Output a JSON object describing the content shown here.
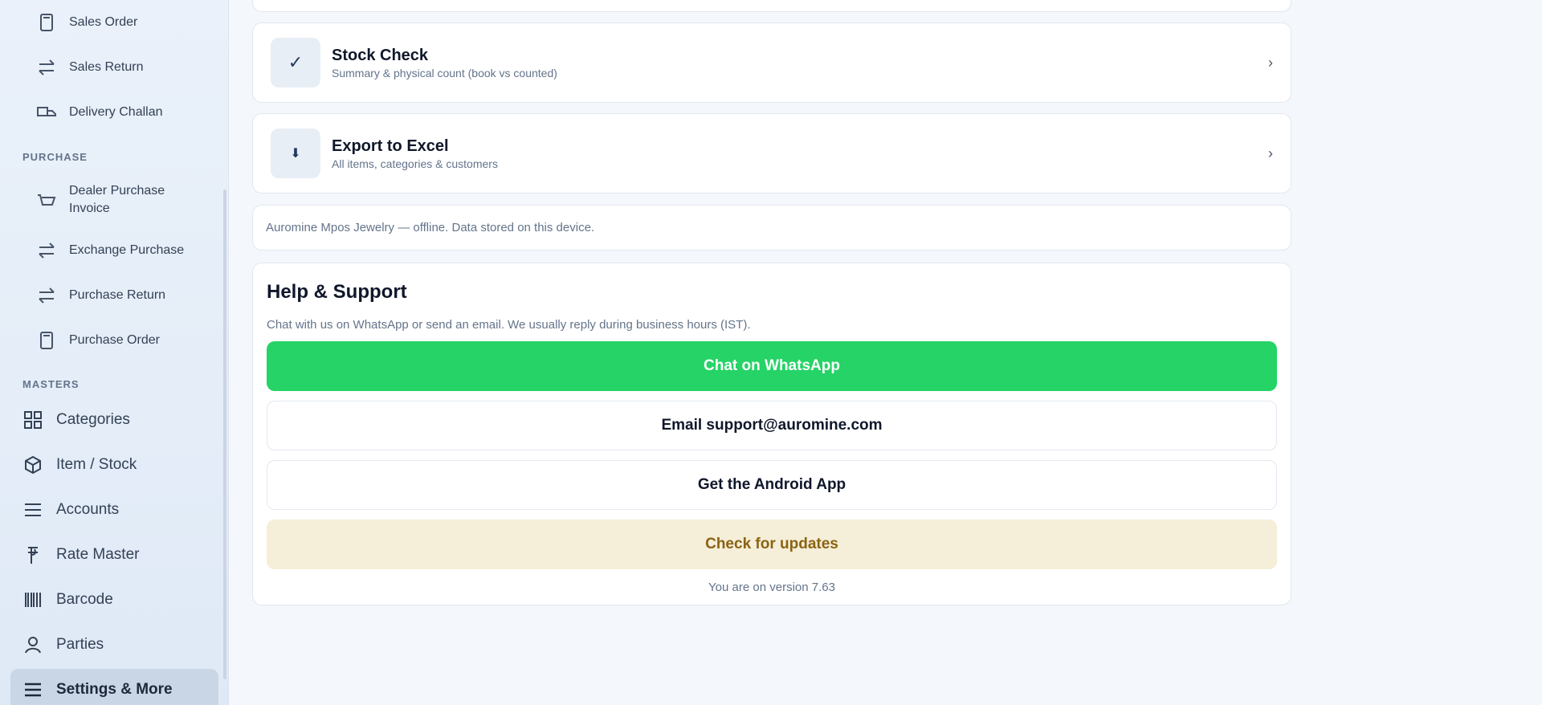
{
  "sidebar": {
    "sales_items": [
      {
        "label": "Sales Order",
        "icon": "receipt-icon"
      },
      {
        "label": "Sales Return",
        "icon": "swap-icon"
      },
      {
        "label": "Delivery Challan",
        "icon": "truck-icon"
      }
    ],
    "purchase_section": "PURCHASE",
    "purchase_items": [
      {
        "label": "Dealer Purchase Invoice",
        "icon": "basket-icon"
      },
      {
        "label": "Exchange Purchase",
        "icon": "swap-icon"
      },
      {
        "label": "Purchase Return",
        "icon": "swap-icon"
      },
      {
        "label": "Purchase Order",
        "icon": "receipt-icon"
      }
    ],
    "masters_section": "MASTERS",
    "masters_items": [
      {
        "label": "Categories",
        "icon": "grid-icon"
      },
      {
        "label": "Item / Stock",
        "icon": "box-icon"
      },
      {
        "label": "Accounts",
        "icon": "list-icon"
      },
      {
        "label": "Rate Master",
        "icon": "rupee-icon"
      },
      {
        "label": "Barcode",
        "icon": "barcode-icon"
      },
      {
        "label": "Parties",
        "icon": "person-icon"
      },
      {
        "label": "Settings & More",
        "icon": "menu-icon",
        "active": true
      }
    ]
  },
  "main": {
    "stock_check": {
      "title": "Stock Check",
      "subtitle": "Summary & physical count (book vs counted)",
      "icon": "✓",
      "chevron": "›"
    },
    "export_excel": {
      "title": "Export to Excel",
      "subtitle": "All items, categories & customers",
      "icon": "⬇",
      "chevron": "›"
    },
    "offline_note": "Auromine Mpos Jewelry — offline. Data stored on this device.",
    "help": {
      "title": "Help & Support",
      "description": "Chat with us on WhatsApp or send an email. We usually reply during business hours (IST).",
      "whatsapp_button": "Chat on WhatsApp",
      "email_button": "Email support@auromine.com",
      "android_button": "Get the Android App",
      "update_button": "Check for updates",
      "version_text": "You are on version 7.63"
    }
  },
  "colors": {
    "accent_green": "#25d366",
    "update_bg": "#f5eed9",
    "update_text": "#8a6412",
    "sidebar_active": "#c9d6e6"
  }
}
